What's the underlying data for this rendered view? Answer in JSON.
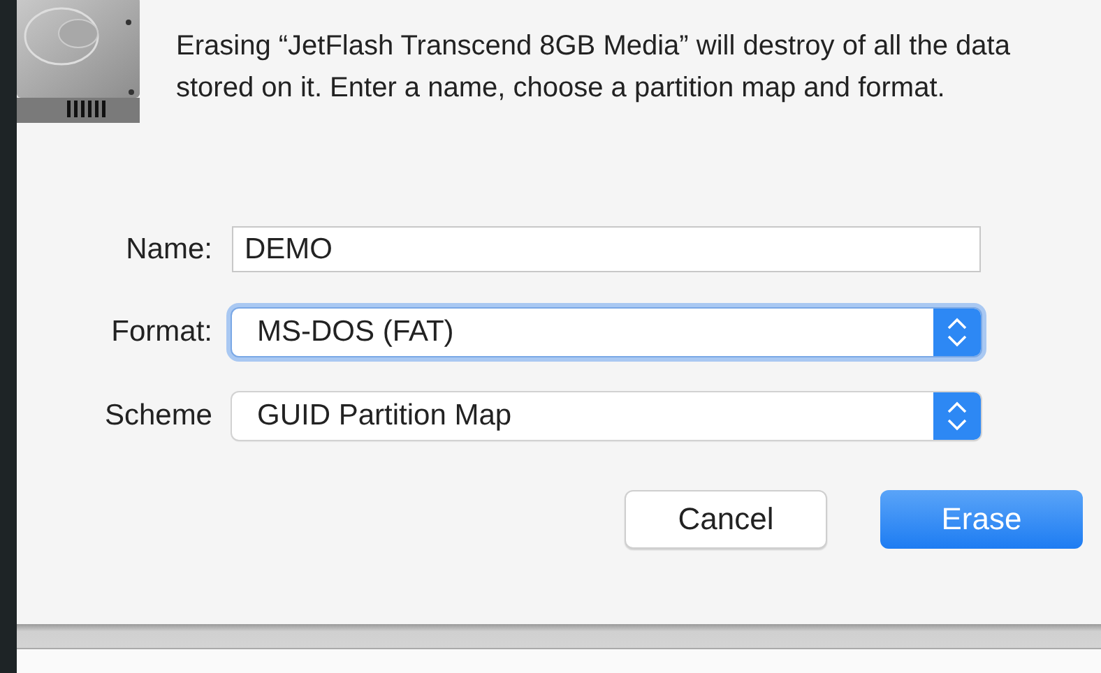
{
  "message": "Erasing “JetFlash Transcend 8GB Media” will destroy of all the data stored on it. Enter a name, choose a partition map and format.",
  "fields": [
    {
      "kind": "text",
      "label": "Name:",
      "value": "DEMO",
      "focused": false
    },
    {
      "kind": "select",
      "label": "Format:",
      "value": "MS-DOS (FAT)",
      "focused": true
    },
    {
      "kind": "select",
      "label": "Scheme",
      "value": "GUID Partition Map",
      "focused": false
    }
  ],
  "buttons": [
    {
      "label": "Cancel",
      "default": false
    },
    {
      "label": "Erase",
      "default": true
    }
  ]
}
